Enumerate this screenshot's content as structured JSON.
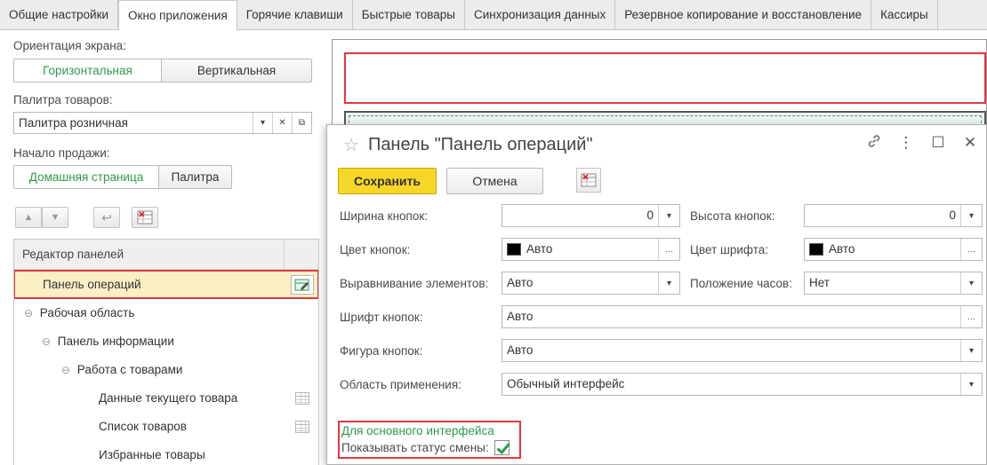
{
  "tabs": [
    "Общие настройки",
    "Окно приложения",
    "Горячие клавиши",
    "Быстрые товары",
    "Синхронизация данных",
    "Резервное копирование и восстановление",
    "Кассиры"
  ],
  "left": {
    "orientation_label": "Ориентация экрана:",
    "orientation_options": [
      "Горизонтальная",
      "Вертикальная"
    ],
    "palette_label": "Палитра товаров:",
    "palette_value": "Палитра розничная",
    "sale_start_label": "Начало продажи:",
    "sale_start_options": [
      "Домашняя страница",
      "Палитра"
    ],
    "tree_header": "Редактор панелей",
    "tree_rows": [
      "Панель операций",
      "Рабочая область",
      "Панель информации",
      "Работа с товарами",
      "Данные текущего товара",
      "Список товаров",
      "Избранные товары"
    ]
  },
  "dialog": {
    "title": "Панель \"Панель операций\"",
    "save_label": "Сохранить",
    "cancel_label": "Отмена",
    "fields": {
      "button_width_label": "Ширина кнопок:",
      "button_width_value": "0",
      "button_height_label": "Высота кнопок:",
      "button_height_value": "0",
      "button_color_label": "Цвет кнопок:",
      "button_color_value": "Авто",
      "font_color_label": "Цвет шрифта:",
      "font_color_value": "Авто",
      "alignment_label": "Выравнивание элементов:",
      "alignment_value": "Авто",
      "clock_position_label": "Положение часов:",
      "clock_position_value": "Нет",
      "button_font_label": "Шрифт кнопок:",
      "button_font_value": "Авто",
      "button_shape_label": "Фигура кнопок:",
      "button_shape_value": "Авто",
      "scope_label": "Область применения:",
      "scope_value": "Обычный интерфейс"
    },
    "group_title": "Для основного интерфейса",
    "show_shift_status_label": "Показывать статус смены:"
  },
  "colors": {
    "accent_green": "#2e9a4a",
    "highlight_red": "#e0393e",
    "save_yellow": "#f6d627",
    "selected_row": "#fbefc6"
  },
  "icons": [
    "star-icon",
    "link-icon",
    "more-icon",
    "maximize-icon",
    "close-icon",
    "arrow-up-icon",
    "arrow-down-icon",
    "undo-icon",
    "table-settings-icon",
    "edit-icon",
    "grid-icon",
    "dropdown-icon",
    "clear-icon",
    "open-icon",
    "ellipsis-icon",
    "checkbox-checked-icon"
  ]
}
